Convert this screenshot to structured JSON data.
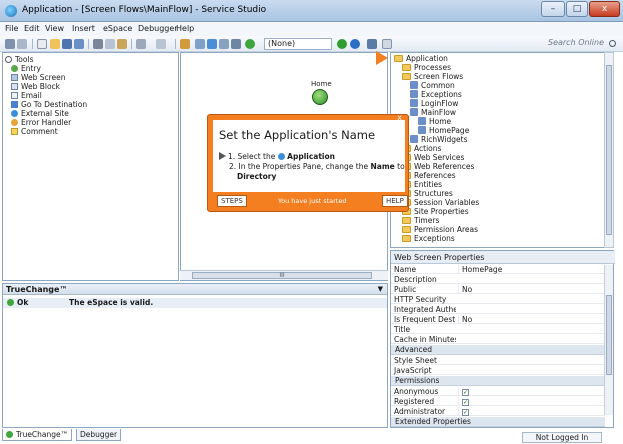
{
  "window": {
    "title": "Application - [Screen Flows\\MainFlow] - Service Studio",
    "minimize": "–",
    "maximize": "□",
    "close": "x"
  },
  "menu": [
    "File",
    "Edit",
    "View",
    "Insert",
    "eSpace",
    "Debugger",
    "Help"
  ],
  "toolbar": {
    "environment": "(None)",
    "search_placeholder": "Search Online"
  },
  "tools": {
    "title": "Tools",
    "items": [
      "Entry",
      "Web Screen",
      "Web Block",
      "Email",
      "Go To Destination",
      "External Site",
      "Error Handler",
      "Comment"
    ]
  },
  "canvas": {
    "node_label": "Home",
    "scroll_label": "III"
  },
  "tree": {
    "items": [
      {
        "label": "Application",
        "indent": 0
      },
      {
        "label": "Processes",
        "indent": 1
      },
      {
        "label": "Screen Flows",
        "indent": 1
      },
      {
        "label": "Common",
        "indent": 2
      },
      {
        "label": "Exceptions",
        "indent": 2
      },
      {
        "label": "LoginFlow",
        "indent": 2
      },
      {
        "label": "MainFlow",
        "indent": 2
      },
      {
        "label": "Home",
        "indent": 3
      },
      {
        "label": "HomePage",
        "indent": 3
      },
      {
        "label": "RichWidgets",
        "indent": 2
      },
      {
        "label": "Actions",
        "indent": 1
      },
      {
        "label": "Web Services",
        "indent": 1
      },
      {
        "label": "Web References",
        "indent": 1
      },
      {
        "label": "References",
        "indent": 1
      },
      {
        "label": "Entities",
        "indent": 1
      },
      {
        "label": "Structures",
        "indent": 1
      },
      {
        "label": "Session Variables",
        "indent": 1
      },
      {
        "label": "Site Properties",
        "indent": 1
      },
      {
        "label": "Timers",
        "indent": 1
      },
      {
        "label": "Permission Areas",
        "indent": 1
      },
      {
        "label": "Exceptions",
        "indent": 1
      }
    ]
  },
  "properties": {
    "title": "Web Screen Properties",
    "rows": [
      {
        "key": "Name",
        "value": "HomePage"
      },
      {
        "key": "Description",
        "value": ""
      },
      {
        "key": "Public",
        "value": "No"
      },
      {
        "key": "HTTP Security",
        "value": ""
      },
      {
        "key": "Integrated Authe...",
        "value": ""
      },
      {
        "key": "Is Frequent Desti...",
        "value": "No"
      },
      {
        "key": "Title",
        "value": ""
      },
      {
        "key": "Cache in Minutes",
        "value": ""
      }
    ],
    "advanced": "Advanced",
    "advanced_rows": [
      {
        "key": "Style Sheet",
        "value": ""
      },
      {
        "key": "JavaScript",
        "value": ""
      }
    ],
    "permissions": "Permissions",
    "permission_rows": [
      {
        "key": "Anonymous",
        "checked": true
      },
      {
        "key": "Registered",
        "checked": true
      },
      {
        "key": "Administrator",
        "checked": true
      }
    ],
    "extended": "Extended Properties"
  },
  "truechange": {
    "title": "TrueChange™",
    "status": "Ok",
    "message": "The eSpace is valid."
  },
  "bottom_tabs": [
    "TrueChange™",
    "Debugger"
  ],
  "statusbar": {
    "login": "Not Logged In"
  },
  "tip": {
    "title": "Set the Application's Name",
    "step1_prefix": "1. Select the",
    "step1_target": "Application",
    "step2_prefix": "2. In the Properties Pane, change the",
    "step2_bold": "Name",
    "step2_suffix": "to",
    "step2_value": "Directory",
    "close": "x",
    "steps_btn": "STEPS",
    "progress": "You have just started",
    "help_btn": "HELP"
  },
  "colors": {
    "accent": "#f47f20",
    "ok": "#3da63d",
    "titlebar": "#a9c4e3"
  }
}
